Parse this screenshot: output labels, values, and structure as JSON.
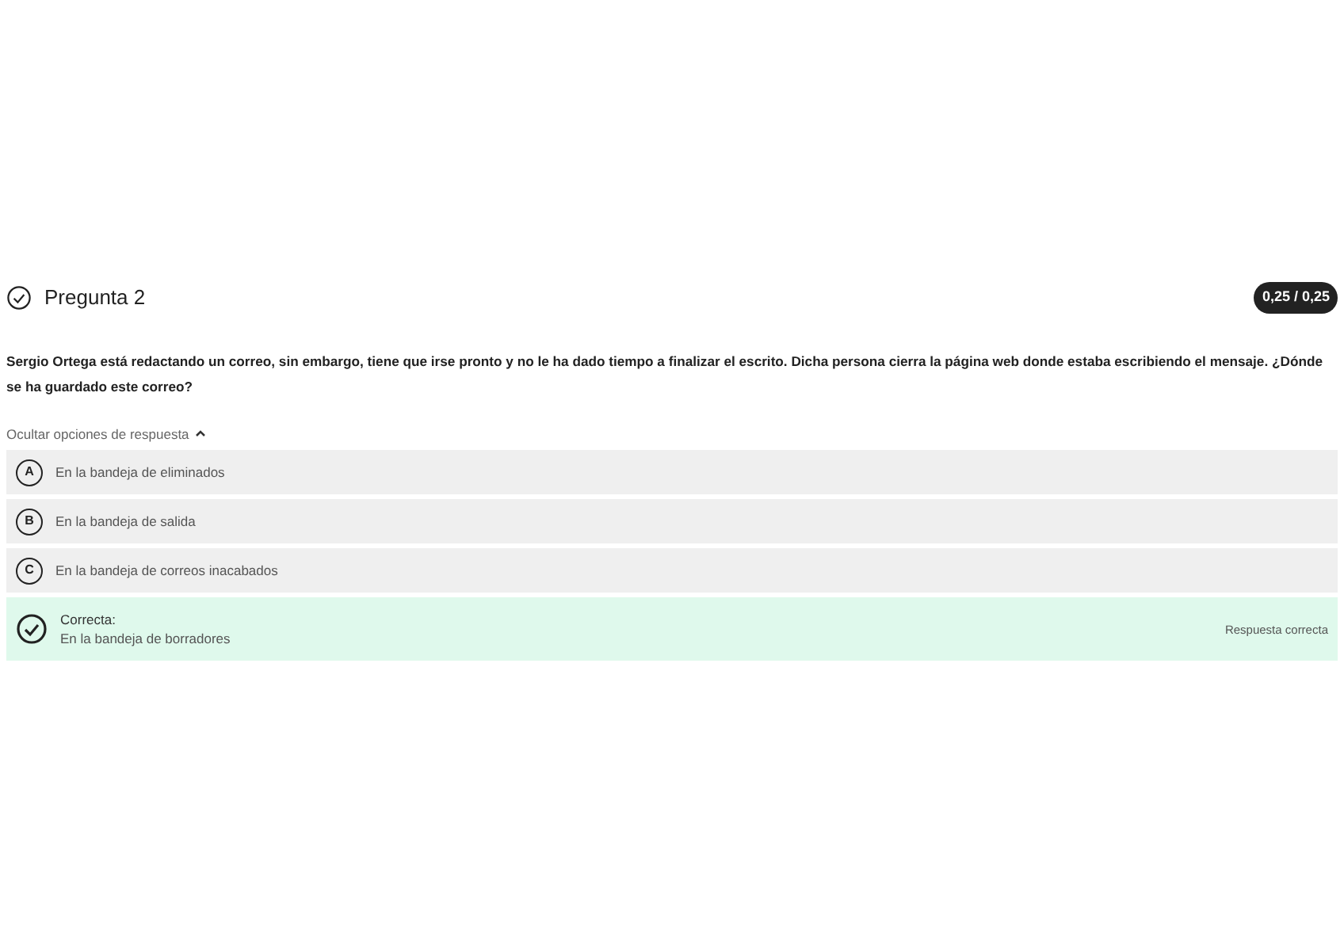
{
  "question": {
    "title": "Pregunta 2",
    "answered_correctly": true,
    "score": "0,25 / 0,25",
    "text": "Sergio Ortega está redactando un correo, sin embargo, tiene que irse pronto y no le ha dado tiempo a finalizar el escrito. Dicha persona cierra la página web donde estaba escribiendo el mensaje. ¿Dónde se ha guardado este correo?"
  },
  "toggle": {
    "label": "Ocultar opciones de respuesta",
    "expanded": true
  },
  "options": [
    {
      "kind": "letter",
      "letter": "A",
      "text": "En la bandeja de eliminados"
    },
    {
      "kind": "letter",
      "letter": "B",
      "text": "En la bandeja de salida"
    },
    {
      "kind": "letter",
      "letter": "C",
      "text": "En la bandeja de correos inacabados"
    },
    {
      "kind": "correct",
      "status": "Correcta:",
      "text": "En la bandeja de borradores",
      "note": "Respuesta correcta"
    }
  ]
}
